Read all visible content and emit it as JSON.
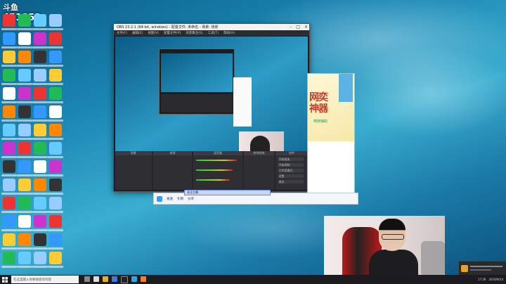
{
  "overlay": {
    "logo": "斗鱼",
    "viewer_count": "451852"
  },
  "obs": {
    "title": "OBS 23.2.1 (64-bit, windows) - 配置文件: 未命名 - 场景: 场景",
    "menu": [
      "文件(F)",
      "编辑(E)",
      "视图(V)",
      "配置文件(P)",
      "场景集合(S)",
      "工具(T)",
      "帮助(H)"
    ],
    "docks": [
      "场景",
      "来源",
      "混音器",
      "转场特效",
      "控件"
    ],
    "controls": [
      "开始推流",
      "开始录制",
      "工作室模式",
      "设置",
      "退出"
    ]
  },
  "promo": {
    "headline": "网奕\n神器",
    "sub": "棋牌辅助"
  },
  "chat": {
    "pill": "关注主播",
    "items": [
      "发送",
      "礼物",
      "分享"
    ]
  },
  "taskbar": {
    "search_placeholder": "在这里输入你要搜索的内容",
    "time": "17:26",
    "date": "2019/9/14"
  },
  "colors": {
    "accent": "#3fa7e8",
    "taskbar": "#1b1b1f"
  }
}
